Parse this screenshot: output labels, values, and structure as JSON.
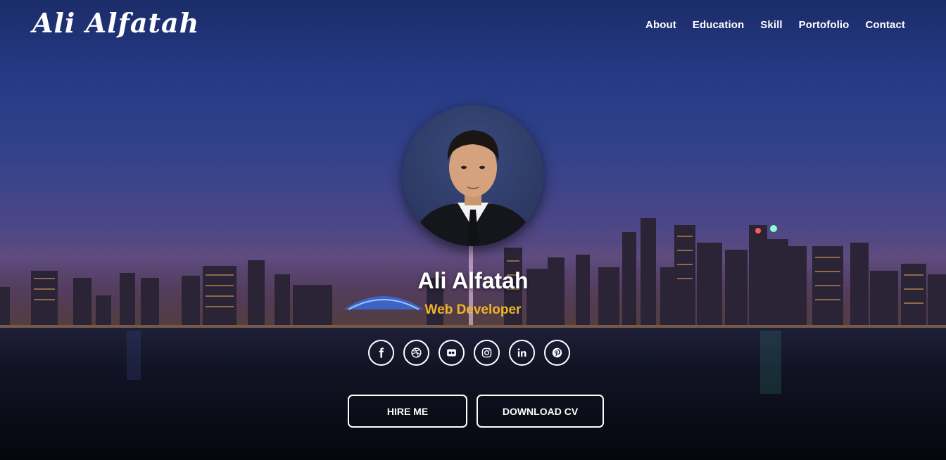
{
  "header": {
    "logo_text": "Ali Alfatah",
    "nav": [
      {
        "label": "About"
      },
      {
        "label": "Education"
      },
      {
        "label": "Skill"
      },
      {
        "label": "Portofolio"
      },
      {
        "label": "Contact"
      }
    ]
  },
  "hero": {
    "name": "Ali Alfatah",
    "role": "Web Developer",
    "role_color": "#f0b429",
    "social": [
      {
        "icon": "facebook-icon"
      },
      {
        "icon": "dribbble-icon"
      },
      {
        "icon": "flickr-icon"
      },
      {
        "icon": "instagram-icon"
      },
      {
        "icon": "linkedin-icon"
      },
      {
        "icon": "pinterest-icon"
      }
    ],
    "buttons": {
      "hire": "HIRE ME",
      "cv": "DOWNLOAD CV"
    }
  }
}
